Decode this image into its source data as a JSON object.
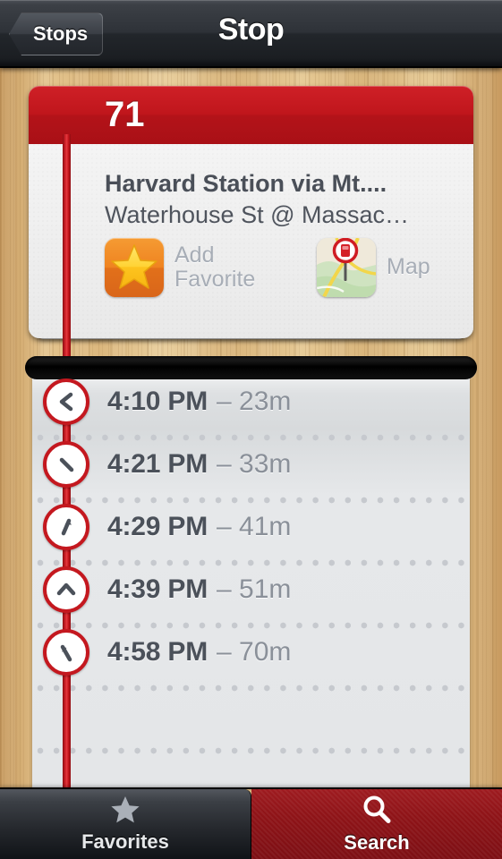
{
  "navbar": {
    "back_label": "Stops",
    "title": "Stop"
  },
  "route_card": {
    "route_number": "71",
    "bus_icon": "bus-icon",
    "destination": "Harvard Station via Mt....",
    "stop_name": "Waterhouse St @ Massac…",
    "actions": [
      {
        "icon": "star-icon",
        "label_line1": "Add",
        "label_line2": "Favorite"
      },
      {
        "icon": "map-pin-icon",
        "label_line1": "Map",
        "label_line2": ""
      }
    ],
    "header_color": "#c0161c"
  },
  "arrivals": [
    {
      "time": "4:10 PM",
      "eta": "– 23m",
      "direction_icon": "arrow-west-icon"
    },
    {
      "time": "4:21 PM",
      "eta": "– 33m",
      "direction_icon": "arrow-southeast-icon"
    },
    {
      "time": "4:29 PM",
      "eta": "– 41m",
      "direction_icon": "arrow-northeast-icon"
    },
    {
      "time": "4:39 PM",
      "eta": "– 51m",
      "direction_icon": "arrow-north-icon"
    },
    {
      "time": "4:58 PM",
      "eta": "– 70m",
      "direction_icon": "arrow-southwest-icon"
    }
  ],
  "tabbar": {
    "tabs": [
      {
        "label": "Favorites",
        "icon": "star-icon",
        "active": false
      },
      {
        "label": "Search",
        "icon": "search-icon",
        "active": true
      }
    ],
    "active_color": "#8e1317"
  }
}
